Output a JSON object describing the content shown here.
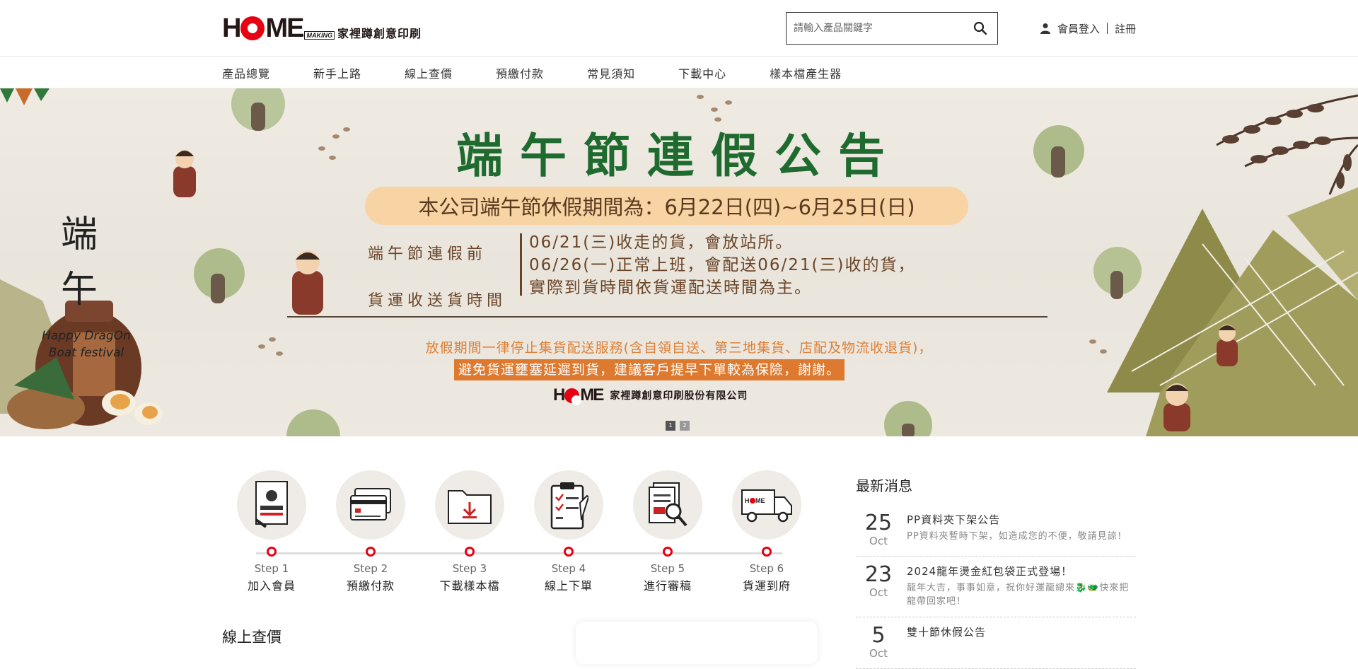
{
  "header": {
    "logo_text": "家裡蹲創意印刷",
    "logo_making": "MAKING",
    "search_placeholder": "請輸入產品關鍵字",
    "login_label": "會員登入",
    "register_label": "註冊"
  },
  "nav": [
    {
      "label": "產品總覽"
    },
    {
      "label": "新手上路"
    },
    {
      "label": "線上查價"
    },
    {
      "label": "預繳付款"
    },
    {
      "label": "常見須知"
    },
    {
      "label": "下載中心"
    },
    {
      "label": "樣本檔產生器"
    }
  ],
  "banner": {
    "side_title_1": "端",
    "side_title_2": "午",
    "side_happy": "Happy DragOn Boat festival",
    "title": "端午節連假公告",
    "pill": "本公司端午節休假期間為：6月22日(四)~6月25日(日)",
    "left_line1": "端午節連假前",
    "left_line2": "貨運收送貨時間",
    "right_line1": "06/21(三)收走的貨，會放站所。",
    "right_line2": "06/26(一)正常上班，會配送06/21(三)收的貨，",
    "right_line3": "實際到貨時間依貨運配送時間為主。",
    "notice1": "放假期間一律停止集貨配送服務(含自領自送、第三地集貨、店配及物流收退貨)，",
    "notice2": "避免貨運壅塞延遲到貨，建議客戶提早下單較為保險，謝謝。",
    "company": "家裡蹲創意印刷股份有限公司",
    "dot1": "1",
    "dot2": "2"
  },
  "steps": [
    {
      "num": "Step 1",
      "name": "加入會員",
      "icon": "member-card-icon"
    },
    {
      "num": "Step 2",
      "name": "預繳付款",
      "icon": "credit-card-icon"
    },
    {
      "num": "Step 3",
      "name": "下載樣本檔",
      "icon": "download-folder-icon"
    },
    {
      "num": "Step 4",
      "name": "線上下單",
      "icon": "clipboard-order-icon"
    },
    {
      "num": "Step 5",
      "name": "進行審稿",
      "icon": "document-review-icon"
    },
    {
      "num": "Step 6",
      "name": "貨運到府",
      "icon": "delivery-truck-icon"
    }
  ],
  "online_title": "線上查價",
  "news": {
    "title": "最新消息",
    "items": [
      {
        "day": "25",
        "month": "Oct",
        "title": "PP資料夾下架公告",
        "desc": "PP資料夾暫時下架，如造成您的不便，敬請見諒！"
      },
      {
        "day": "23",
        "month": "Oct",
        "title": "2024龍年燙金紅包袋正式登場！",
        "desc": "龍年大吉，事事如意，祝你好運龍總來🐉🐲快來把龍帶回家吧！"
      },
      {
        "day": "5",
        "month": "Oct",
        "title": "雙十節休假公告",
        "desc": ""
      }
    ]
  },
  "colors": {
    "brand_red": "#e60012",
    "banner_green": "#1f6b2f",
    "banner_orange": "#de7a2f",
    "pill_bg": "#f8d3a4"
  }
}
